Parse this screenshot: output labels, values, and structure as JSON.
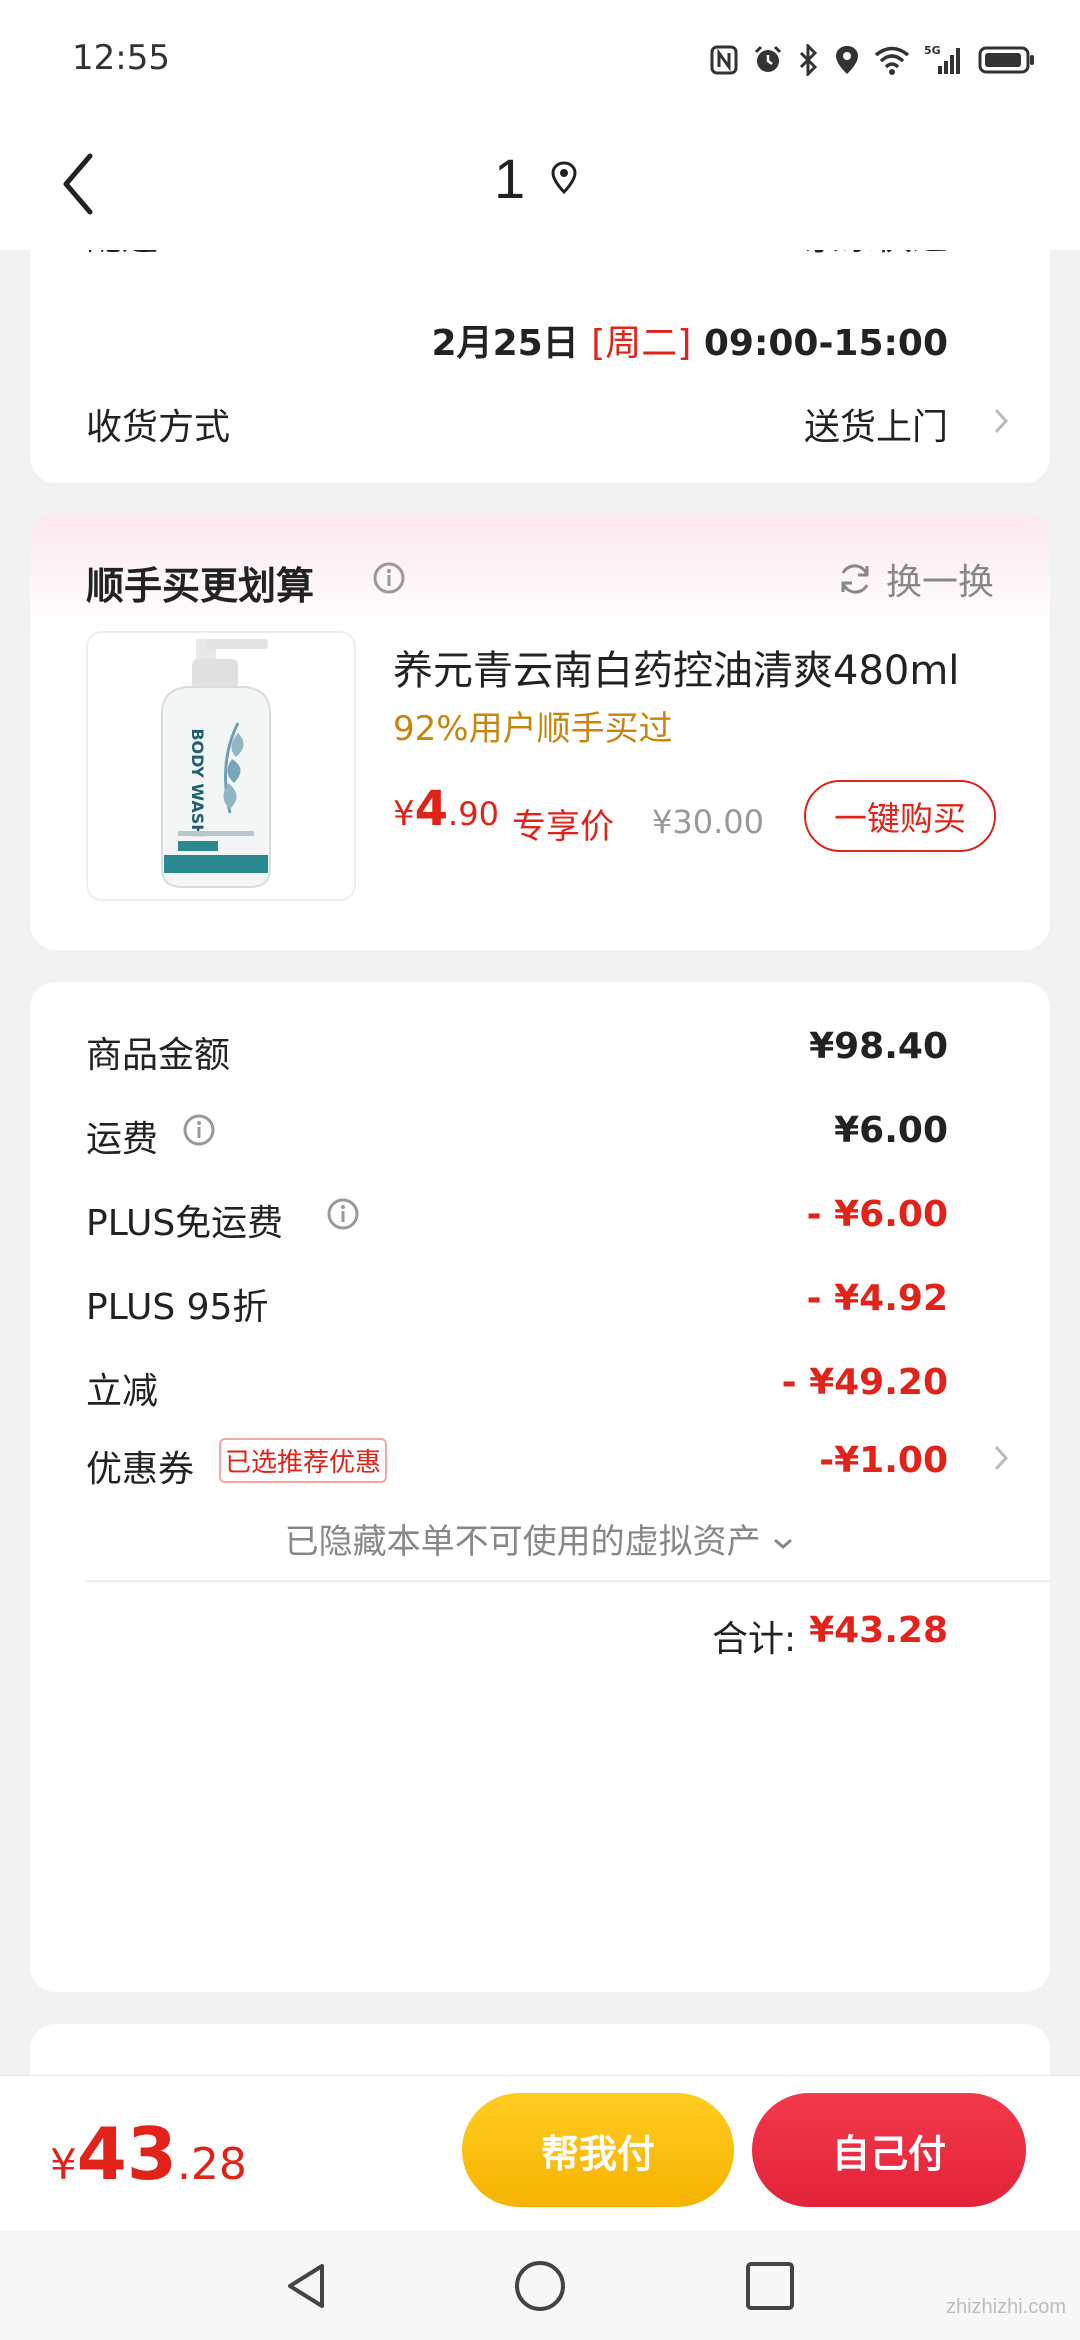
{
  "status_bar": {
    "time": "12:55",
    "network": "5G"
  },
  "nav": {
    "title": "1"
  },
  "delivery": {
    "cut_label": "配送",
    "cut_value": "京东快递",
    "date": "2月25日",
    "weekday": "[周二]",
    "time_range": "09:00-15:00",
    "method_label": "收货方式",
    "method_value": "送货上门"
  },
  "recommend": {
    "title": "顺手买更划算",
    "swap_label": "换一换",
    "product": {
      "name": "养元青云南白药控油清爽480ml",
      "subtitle": "92%用户顺手买过",
      "price_currency": "¥",
      "price_int": "4",
      "price_dec": ".90",
      "price_tag": "专享价",
      "original_price": "¥30.00",
      "buy_label": "一键购买",
      "image_text": "BODY WASH"
    }
  },
  "price_detail": {
    "rows": [
      {
        "label": "商品金额",
        "value": "¥98.40"
      },
      {
        "label": "运费",
        "value": "¥6.00"
      },
      {
        "label": "PLUS免运费",
        "value": "- ¥6.00"
      },
      {
        "label": "PLUS 95折",
        "value": "- ¥4.92"
      },
      {
        "label": "立减",
        "value": "- ¥49.20"
      },
      {
        "label": "优惠券",
        "value": "-¥1.00"
      }
    ],
    "coupon_tag": "已选推荐优惠",
    "hidden_note": "已隐藏本单不可使用的虚拟资产",
    "total_label": "合计:",
    "total_value": "¥43.28"
  },
  "bottom_bar": {
    "currency": "¥",
    "amount_int": "43",
    "amount_dec": ".28",
    "help_pay_label": "帮我付",
    "self_pay_label": "自己付"
  },
  "watermark": "zhizhizhi.com",
  "colors": {
    "accent_red": "#e2231a",
    "help_yellow": "#f7b300",
    "subtitle_gold": "#c8860c"
  }
}
